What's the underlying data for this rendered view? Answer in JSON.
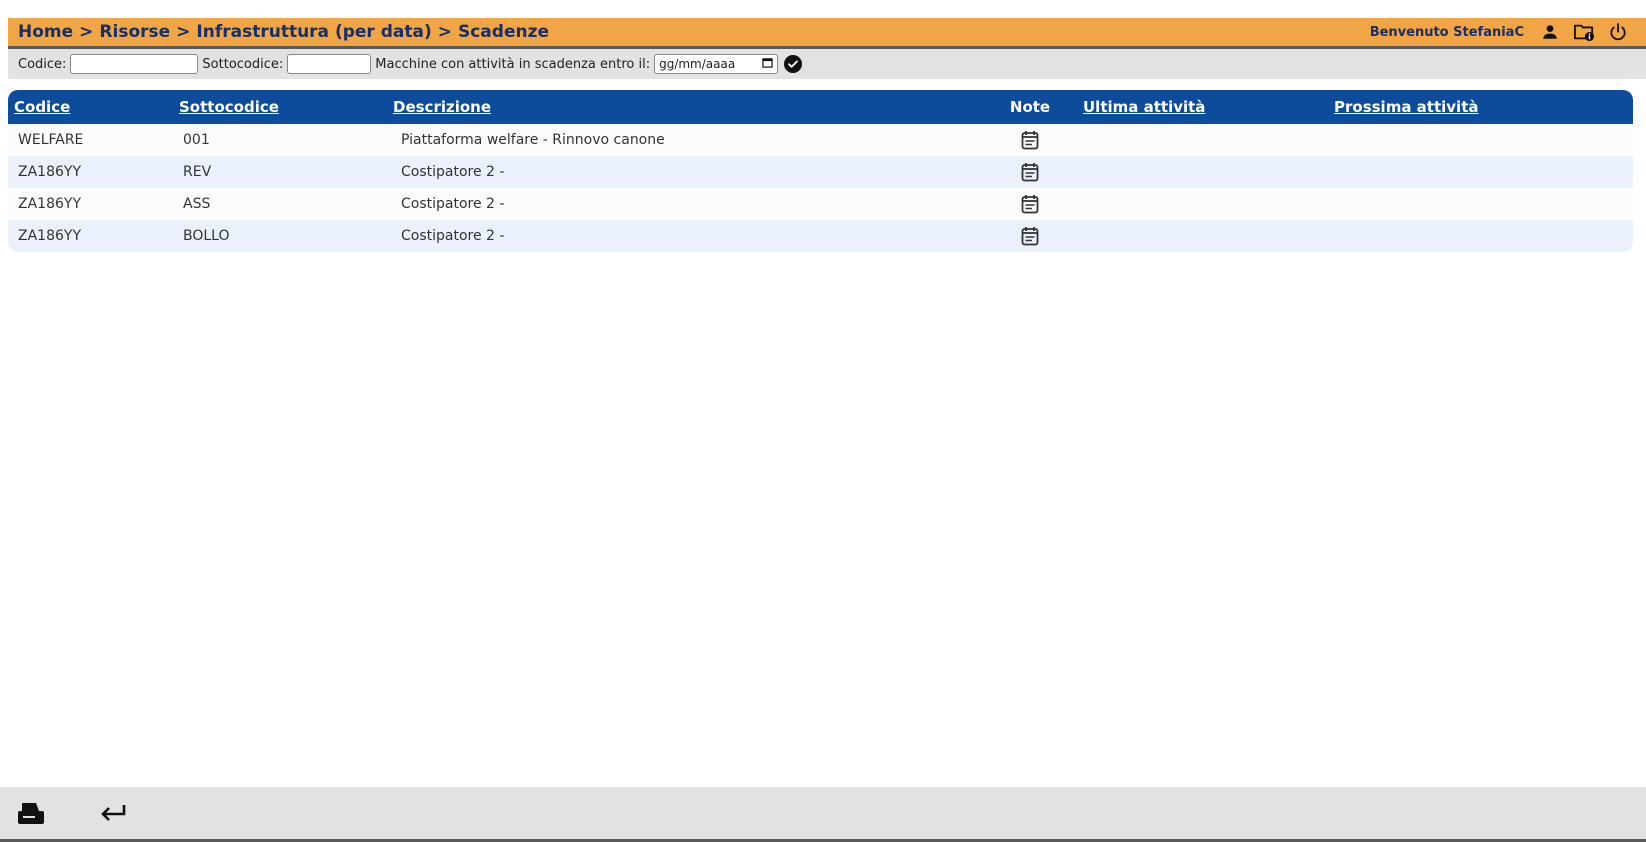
{
  "header": {
    "breadcrumb": [
      "Home",
      "Risorse",
      "Infrastruttura (per data)",
      "Scadenze"
    ],
    "separator": ">",
    "welcome": "Benvenuto StefaniaC",
    "icons": [
      "user-icon",
      "folder-info-icon",
      "power-icon"
    ]
  },
  "filters": {
    "codice_label": "Codice:",
    "codice_value": "",
    "sottocodice_label": "Sottocodice:",
    "sottocodice_value": "",
    "scadenza_label": "Macchine con attività in scadenza entro il:",
    "date_placeholder": "gg/mm/aaaa"
  },
  "table": {
    "columns": [
      "Codice",
      "Sottocodice",
      "Descrizione",
      "Note",
      "Ultima attività",
      "Prossima attività"
    ],
    "rows": [
      {
        "codice": "WELFARE",
        "sottocodice": "001",
        "descrizione": "Piattaforma welfare - Rinnovo canone",
        "ultima": "",
        "prossima": ""
      },
      {
        "codice": "ZA186YY",
        "sottocodice": "REV",
        "descrizione": "Costipatore 2 -",
        "ultima": "",
        "prossima": ""
      },
      {
        "codice": "ZA186YY",
        "sottocodice": "ASS",
        "descrizione": "Costipatore 2 -",
        "ultima": "",
        "prossima": ""
      },
      {
        "codice": "ZA186YY",
        "sottocodice": "BOLLO",
        "descrizione": "Costipatore 2 -",
        "ultima": "",
        "prossima": ""
      }
    ]
  },
  "footer": {
    "icons": [
      "print-icon",
      "return-icon"
    ]
  },
  "colors": {
    "header_bg": "#f2a544",
    "header_text": "#15306b",
    "table_header_bg": "#0d4c9b",
    "row_alt_bg": "#eaf1fa",
    "filter_bg": "#e2e2e2"
  }
}
